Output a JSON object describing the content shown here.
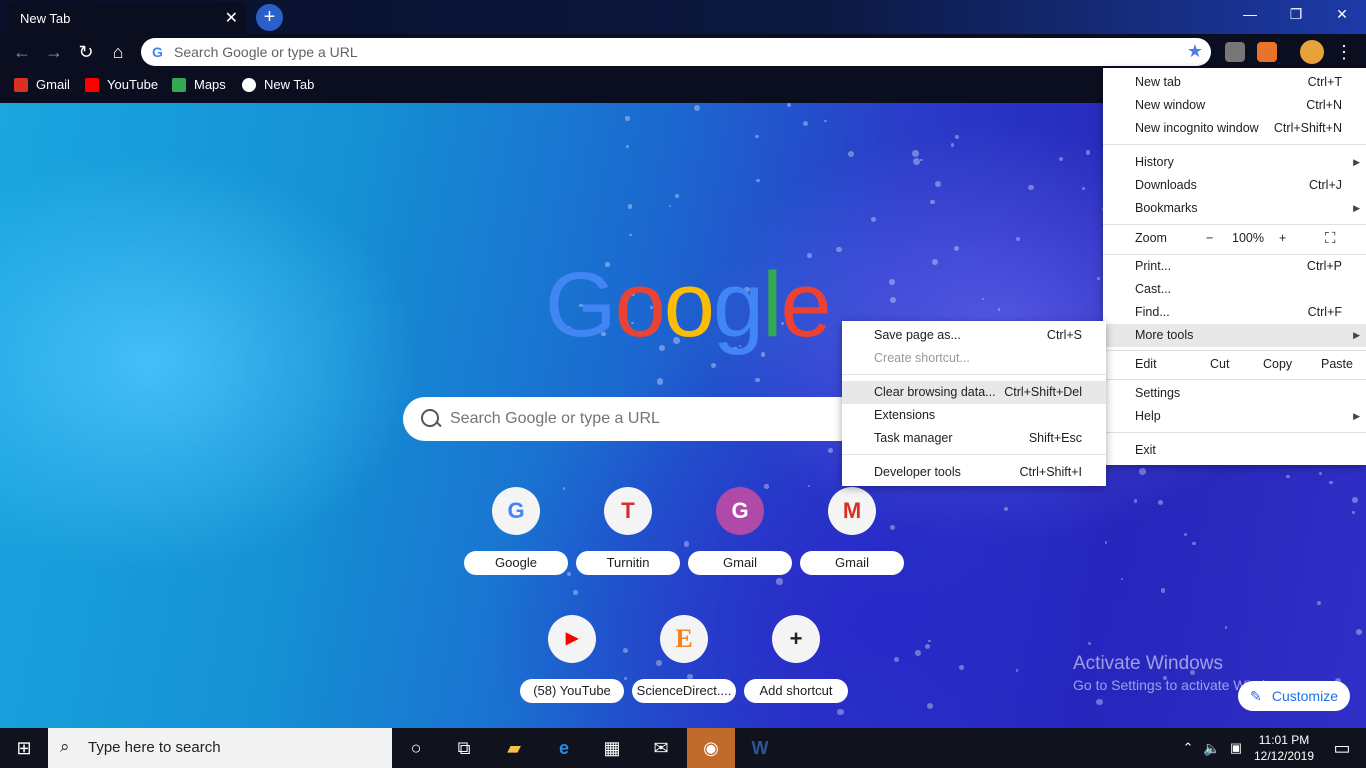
{
  "tab": {
    "title": "New Tab"
  },
  "toolbar": {
    "omnibox_placeholder": "Search Google or type a URL"
  },
  "bookmarks": [
    {
      "label": "Gmail",
      "color": "#d93025"
    },
    {
      "label": "YouTube",
      "color": "#ff0000"
    },
    {
      "label": "Maps",
      "color": "#34a853"
    },
    {
      "label": "New Tab",
      "color": "#ffffff"
    }
  ],
  "newtab": {
    "logo_letters": [
      "G",
      "o",
      "o",
      "g",
      "l",
      "e"
    ],
    "logo_colors": [
      "#4285f4",
      "#ea4335",
      "#fbbc05",
      "#4285f4",
      "#34a853",
      "#ea4335"
    ],
    "search_placeholder": "Search Google or type a URL",
    "shortcuts": [
      {
        "label": "Google",
        "icon": "G",
        "icon_color": "#4285f4"
      },
      {
        "label": "Turnitin",
        "icon": "T",
        "icon_color": "#d32f2f"
      },
      {
        "label": "Gmail",
        "icon": "G",
        "icon_color": "#ffffff"
      },
      {
        "label": "Gmail",
        "icon": "M",
        "icon_color": "#d93025"
      },
      {
        "label": "(58) YouTube",
        "icon": "▶",
        "icon_color": "#ff0000"
      },
      {
        "label": "ScienceDirect....",
        "icon": "E",
        "icon_color": "#f58220"
      },
      {
        "label": "Add shortcut",
        "icon": "+",
        "icon_color": "#202124"
      }
    ],
    "customize_label": "Customize",
    "activate_title": "Activate Windows",
    "activate_sub": "Go to Settings to activate Windows."
  },
  "chrome_menu": {
    "items": [
      {
        "label": "New tab",
        "shortcut": "Ctrl+T"
      },
      {
        "label": "New window",
        "shortcut": "Ctrl+N"
      },
      {
        "label": "New incognito window",
        "shortcut": "Ctrl+Shift+N"
      },
      {
        "label": "History",
        "shortcut": ""
      },
      {
        "label": "Downloads",
        "shortcut": "Ctrl+J"
      },
      {
        "label": "Bookmarks",
        "shortcut": ""
      },
      {
        "label": "Print...",
        "shortcut": "Ctrl+P"
      },
      {
        "label": "Cast...",
        "shortcut": ""
      },
      {
        "label": "Find...",
        "shortcut": "Ctrl+F"
      },
      {
        "label": "More tools",
        "shortcut": ""
      },
      {
        "label": "Settings",
        "shortcut": ""
      },
      {
        "label": "Help",
        "shortcut": ""
      },
      {
        "label": "Exit",
        "shortcut": ""
      }
    ],
    "zoom": {
      "label": "Zoom",
      "minus": "−",
      "value": "100%",
      "plus": "+"
    },
    "edit": {
      "label": "Edit",
      "cut": "Cut",
      "copy": "Copy",
      "paste": "Paste"
    }
  },
  "more_tools_menu": {
    "items": [
      {
        "label": "Save page as...",
        "shortcut": "Ctrl+S",
        "disabled": false
      },
      {
        "label": "Create shortcut...",
        "shortcut": "",
        "disabled": true
      },
      {
        "label": "Clear browsing data...",
        "shortcut": "Ctrl+Shift+Del",
        "disabled": false
      },
      {
        "label": "Extensions",
        "shortcut": "",
        "disabled": false
      },
      {
        "label": "Task manager",
        "shortcut": "Shift+Esc",
        "disabled": false
      },
      {
        "label": "Developer tools",
        "shortcut": "Ctrl+Shift+I",
        "disabled": false
      }
    ]
  },
  "taskbar": {
    "search_placeholder": "Type here to search",
    "time": "11:01 PM",
    "date": "12/12/2019"
  }
}
